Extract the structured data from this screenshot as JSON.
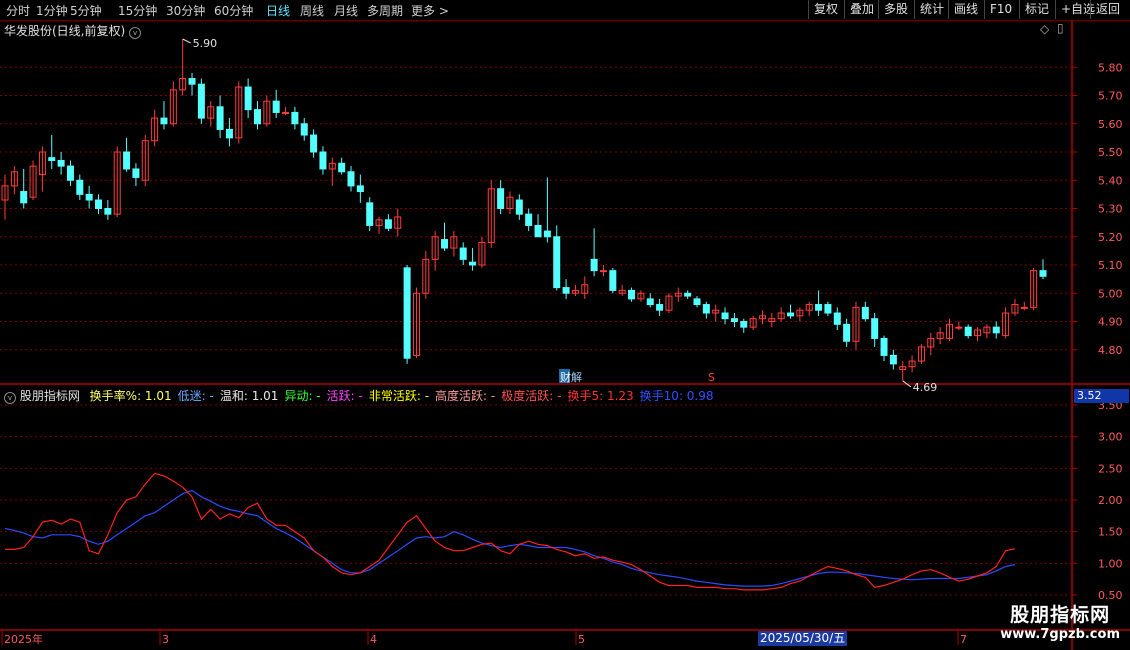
{
  "toolbar": {
    "periods": [
      {
        "label": "分时",
        "active": false
      },
      {
        "label": "1分钟",
        "active": false
      },
      {
        "label": "5分钟",
        "active": false
      },
      {
        "label": "15分钟",
        "active": false
      },
      {
        "label": "30分钟",
        "active": false
      },
      {
        "label": "60分钟",
        "active": false
      },
      {
        "label": "日线",
        "active": true
      },
      {
        "label": "周线",
        "active": false
      },
      {
        "label": "月线",
        "active": false
      },
      {
        "label": "多周期",
        "active": false
      },
      {
        "label": "更多 >",
        "active": false
      }
    ],
    "right_buttons": [
      "复权",
      "叠加",
      "多股",
      "统计",
      "画线",
      "F10",
      "标记",
      "+自选",
      "返回"
    ]
  },
  "main_chart": {
    "title": "华发股份(日线,前复权)",
    "high_label": "5.90",
    "low_label": "4.69",
    "marker_report": "财",
    "marker_unlock": "解",
    "marker_s": "S",
    "price_axis": [
      "5.80",
      "5.70",
      "5.60",
      "5.50",
      "5.40",
      "5.30",
      "5.20",
      "5.10",
      "5.00",
      "4.90",
      "4.80"
    ],
    "colors": {
      "up": "#ff3c3c",
      "down": "#54ffff",
      "grid": "#7a0000"
    }
  },
  "indicator": {
    "name": "股朋指标网",
    "items": [
      {
        "label": "换手率%: 1.01",
        "color": "#ffff66"
      },
      {
        "label": "低迷: -",
        "color": "#6aa8ff"
      },
      {
        "label": "温和: 1.01",
        "color": "#e8e8e8"
      },
      {
        "label": "异动: -",
        "color": "#33ff33"
      },
      {
        "label": "活跃: -",
        "color": "#ff44ff"
      },
      {
        "label": "非常活跃: -",
        "color": "#ffff00"
      },
      {
        "label": "高度活跃: -",
        "color": "#ff9a9a"
      },
      {
        "label": "极度活跃: -",
        "color": "#ff5050"
      },
      {
        "label": "换手5: 1.23",
        "color": "#ff3030"
      },
      {
        "label": "换手10: 0.98",
        "color": "#3050ff"
      }
    ],
    "current_value": "3.52",
    "axis": [
      "3.50",
      "3.00",
      "2.50",
      "2.00",
      "1.50",
      "1.00",
      "0.50"
    ]
  },
  "date_axis": {
    "labels": [
      "2025年",
      "3",
      "4",
      "5",
      "7"
    ],
    "cursor_date": "2025/05/30/五"
  },
  "watermark": {
    "line1": "股朋指标网",
    "line2": "www.7gpzb.com"
  },
  "chart_data": {
    "type": "candlestick",
    "note_series": "OHLC daily, then two turnover moving averages",
    "ohlc": [
      [
        5.33,
        5.42,
        5.26,
        5.38
      ],
      [
        5.38,
        5.45,
        5.35,
        5.43
      ],
      [
        5.36,
        5.44,
        5.3,
        5.32
      ],
      [
        5.34,
        5.47,
        5.33,
        5.45
      ],
      [
        5.42,
        5.52,
        5.36,
        5.5
      ],
      [
        5.48,
        5.56,
        5.44,
        5.47
      ],
      [
        5.47,
        5.5,
        5.42,
        5.45
      ],
      [
        5.45,
        5.47,
        5.38,
        5.4
      ],
      [
        5.4,
        5.42,
        5.33,
        5.35
      ],
      [
        5.35,
        5.38,
        5.3,
        5.33
      ],
      [
        5.33,
        5.35,
        5.28,
        5.3
      ],
      [
        5.3,
        5.33,
        5.26,
        5.28
      ],
      [
        5.28,
        5.52,
        5.27,
        5.5
      ],
      [
        5.5,
        5.55,
        5.43,
        5.44
      ],
      [
        5.44,
        5.46,
        5.38,
        5.41
      ],
      [
        5.4,
        5.56,
        5.38,
        5.54
      ],
      [
        5.54,
        5.65,
        5.52,
        5.62
      ],
      [
        5.62,
        5.68,
        5.58,
        5.6
      ],
      [
        5.6,
        5.75,
        5.59,
        5.72
      ],
      [
        5.72,
        5.9,
        5.7,
        5.76
      ],
      [
        5.76,
        5.78,
        5.7,
        5.74
      ],
      [
        5.74,
        5.76,
        5.6,
        5.62
      ],
      [
        5.62,
        5.68,
        5.59,
        5.66
      ],
      [
        5.66,
        5.7,
        5.55,
        5.58
      ],
      [
        5.58,
        5.62,
        5.52,
        5.55
      ],
      [
        5.55,
        5.75,
        5.53,
        5.73
      ],
      [
        5.73,
        5.76,
        5.62,
        5.65
      ],
      [
        5.65,
        5.68,
        5.58,
        5.6
      ],
      [
        5.6,
        5.7,
        5.59,
        5.68
      ],
      [
        5.68,
        5.72,
        5.62,
        5.64
      ],
      [
        5.64,
        5.66,
        5.63,
        5.64
      ],
      [
        5.64,
        5.66,
        5.58,
        5.6
      ],
      [
        5.6,
        5.62,
        5.54,
        5.56
      ],
      [
        5.56,
        5.58,
        5.48,
        5.5
      ],
      [
        5.5,
        5.52,
        5.42,
        5.44
      ],
      [
        5.44,
        5.48,
        5.38,
        5.46
      ],
      [
        5.46,
        5.48,
        5.42,
        5.43
      ],
      [
        5.43,
        5.45,
        5.36,
        5.38
      ],
      [
        5.38,
        5.42,
        5.32,
        5.36
      ],
      [
        5.32,
        5.34,
        5.22,
        5.24
      ],
      [
        5.24,
        5.27,
        5.21,
        5.26
      ],
      [
        5.26,
        5.28,
        5.22,
        5.23
      ],
      [
        5.23,
        5.3,
        5.2,
        5.27
      ],
      [
        5.09,
        5.1,
        4.75,
        4.77
      ],
      [
        4.78,
        5.02,
        4.77,
        5.0
      ],
      [
        5.0,
        5.15,
        4.98,
        5.12
      ],
      [
        5.12,
        5.22,
        5.08,
        5.2
      ],
      [
        5.19,
        5.25,
        5.15,
        5.16
      ],
      [
        5.16,
        5.22,
        5.13,
        5.2
      ],
      [
        5.16,
        5.18,
        5.1,
        5.12
      ],
      [
        5.11,
        5.16,
        5.08,
        5.1
      ],
      [
        5.1,
        5.2,
        5.09,
        5.18
      ],
      [
        5.18,
        5.4,
        5.16,
        5.37
      ],
      [
        5.37,
        5.4,
        5.28,
        5.3
      ],
      [
        5.3,
        5.36,
        5.28,
        5.34
      ],
      [
        5.33,
        5.35,
        5.26,
        5.28
      ],
      [
        5.28,
        5.3,
        5.22,
        5.24
      ],
      [
        5.24,
        5.28,
        5.22,
        5.2
      ],
      [
        5.22,
        5.41,
        5.18,
        5.2
      ],
      [
        5.2,
        5.24,
        5.01,
        5.02
      ],
      [
        5.02,
        5.05,
        4.98,
        5.0
      ],
      [
        5.0,
        5.03,
        4.99,
        5.01
      ],
      [
        5.0,
        5.06,
        4.98,
        5.03
      ],
      [
        5.12,
        5.23,
        5.06,
        5.08
      ],
      [
        5.08,
        5.1,
        5.06,
        5.08
      ],
      [
        5.08,
        5.09,
        5.0,
        5.01
      ],
      [
        5.0,
        5.03,
        4.99,
        5.01
      ],
      [
        5.01,
        5.02,
        4.97,
        4.98
      ],
      [
        4.98,
        5.01,
        4.97,
        5.0
      ],
      [
        4.98,
        5.0,
        4.95,
        4.96
      ],
      [
        4.96,
        4.98,
        4.92,
        4.94
      ],
      [
        4.94,
        5.0,
        4.93,
        4.99
      ],
      [
        4.99,
        5.02,
        4.97,
        5.0
      ],
      [
        5.0,
        5.01,
        4.98,
        4.99
      ],
      [
        4.98,
        4.99,
        4.95,
        4.96
      ],
      [
        4.96,
        4.97,
        4.91,
        4.93
      ],
      [
        4.93,
        4.96,
        4.9,
        4.94
      ],
      [
        4.93,
        4.95,
        4.89,
        4.91
      ],
      [
        4.91,
        4.93,
        4.88,
        4.9
      ],
      [
        4.9,
        4.91,
        4.86,
        4.88
      ],
      [
        4.88,
        4.92,
        4.87,
        4.91
      ],
      [
        4.91,
        4.94,
        4.89,
        4.92
      ],
      [
        4.9,
        4.93,
        4.88,
        4.91
      ],
      [
        4.91,
        4.95,
        4.9,
        4.93
      ],
      [
        4.93,
        4.96,
        4.91,
        4.92
      ],
      [
        4.92,
        4.95,
        4.9,
        4.94
      ],
      [
        4.94,
        4.97,
        4.92,
        4.96
      ],
      [
        4.96,
        5.01,
        4.92,
        4.94
      ],
      [
        4.96,
        4.97,
        4.92,
        4.93
      ],
      [
        4.93,
        4.95,
        4.87,
        4.89
      ],
      [
        4.89,
        4.91,
        4.81,
        4.83
      ],
      [
        4.83,
        4.97,
        4.8,
        4.95
      ],
      [
        4.95,
        4.97,
        4.9,
        4.91
      ],
      [
        4.91,
        4.93,
        4.81,
        4.84
      ],
      [
        4.84,
        4.85,
        4.76,
        4.78
      ],
      [
        4.78,
        4.8,
        4.73,
        4.75
      ],
      [
        4.73,
        4.76,
        4.69,
        4.74
      ],
      [
        4.74,
        4.78,
        4.72,
        4.76
      ],
      [
        4.76,
        4.82,
        4.75,
        4.81
      ],
      [
        4.81,
        4.86,
        4.78,
        4.84
      ],
      [
        4.84,
        4.88,
        4.82,
        4.86
      ],
      [
        4.84,
        4.91,
        4.83,
        4.89
      ],
      [
        4.88,
        4.9,
        4.87,
        4.88
      ],
      [
        4.88,
        4.89,
        4.84,
        4.85
      ],
      [
        4.85,
        4.88,
        4.83,
        4.87
      ],
      [
        4.86,
        4.89,
        4.84,
        4.88
      ],
      [
        4.88,
        4.9,
        4.84,
        4.86
      ],
      [
        4.85,
        4.95,
        4.84,
        4.93
      ],
      [
        4.93,
        4.98,
        4.92,
        4.96
      ],
      [
        4.95,
        4.97,
        4.94,
        4.95
      ],
      [
        4.95,
        5.09,
        4.94,
        5.08
      ],
      [
        5.08,
        5.12,
        5.05,
        5.06
      ]
    ],
    "turnover_ma5": [
      1.22,
      1.22,
      1.25,
      1.42,
      1.65,
      1.68,
      1.62,
      1.7,
      1.65,
      1.2,
      1.15,
      1.45,
      1.8,
      2.0,
      2.05,
      2.25,
      2.42,
      2.38,
      2.3,
      2.2,
      2.05,
      1.7,
      1.85,
      1.7,
      1.78,
      1.72,
      1.88,
      1.95,
      1.7,
      1.6,
      1.6,
      1.5,
      1.4,
      1.2,
      1.1,
      0.95,
      0.85,
      0.82,
      0.85,
      0.95,
      1.05,
      1.25,
      1.45,
      1.65,
      1.75,
      1.55,
      1.35,
      1.25,
      1.2,
      1.2,
      1.25,
      1.3,
      1.32,
      1.2,
      1.15,
      1.3,
      1.35,
      1.3,
      1.28,
      1.22,
      1.18,
      1.12,
      1.15,
      1.08,
      1.1,
      1.05,
      1.02,
      0.98,
      0.9,
      0.8,
      0.7,
      0.65,
      0.65,
      0.65,
      0.62,
      0.62,
      0.62,
      0.6,
      0.6,
      0.58,
      0.58,
      0.58,
      0.6,
      0.62,
      0.68,
      0.72,
      0.8,
      0.88,
      0.95,
      0.92,
      0.88,
      0.82,
      0.78,
      0.62,
      0.65,
      0.7,
      0.75,
      0.82,
      0.88,
      0.9,
      0.85,
      0.78,
      0.72,
      0.75,
      0.8,
      0.85,
      0.95,
      1.2,
      1.23
    ],
    "turnover_ma10": [
      1.55,
      1.52,
      1.48,
      1.42,
      1.4,
      1.45,
      1.45,
      1.45,
      1.42,
      1.35,
      1.3,
      1.35,
      1.45,
      1.55,
      1.65,
      1.75,
      1.8,
      1.9,
      2.0,
      2.1,
      2.15,
      2.05,
      1.98,
      1.9,
      1.85,
      1.82,
      1.78,
      1.75,
      1.65,
      1.55,
      1.48,
      1.4,
      1.3,
      1.2,
      1.1,
      1.0,
      0.9,
      0.85,
      0.85,
      0.9,
      1.0,
      1.1,
      1.2,
      1.3,
      1.4,
      1.42,
      1.4,
      1.42,
      1.5,
      1.45,
      1.38,
      1.32,
      1.28,
      1.25,
      1.28,
      1.3,
      1.28,
      1.25,
      1.25,
      1.25,
      1.25,
      1.22,
      1.18,
      1.12,
      1.08,
      1.02,
      0.98,
      0.92,
      0.88,
      0.85,
      0.82,
      0.8,
      0.78,
      0.75,
      0.72,
      0.7,
      0.68,
      0.66,
      0.65,
      0.64,
      0.64,
      0.64,
      0.65,
      0.68,
      0.72,
      0.76,
      0.8,
      0.84,
      0.86,
      0.86,
      0.85,
      0.84,
      0.82,
      0.8,
      0.78,
      0.76,
      0.75,
      0.74,
      0.75,
      0.76,
      0.76,
      0.76,
      0.76,
      0.78,
      0.8,
      0.82,
      0.88,
      0.95,
      0.98
    ],
    "price_range": [
      4.7,
      5.9
    ],
    "turnover_range": [
      0.5,
      3.5
    ]
  }
}
